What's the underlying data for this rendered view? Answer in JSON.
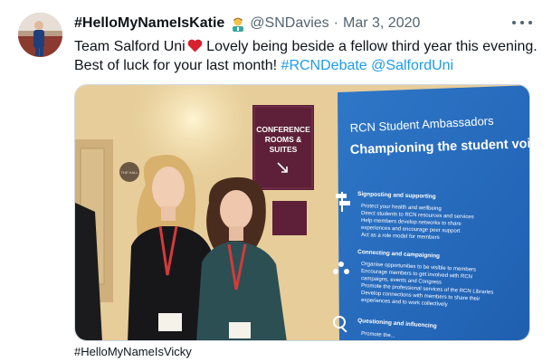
{
  "tweet": {
    "display_name": "#HelloMyNameIsKatie",
    "emoji_icon": "health-worker-emoji",
    "handle": "@SNDavies",
    "separator": "·",
    "date": "Mar 3, 2020",
    "text_part1": "Team Salford Uni",
    "text_part2": " Lovely being beside a fellow third year this evening.",
    "text_part3": "Best of luck for your last month! ",
    "hashtag": "#RCNDebate",
    "mention": "@SalfordUni",
    "link_color": "#1d9bf0",
    "more_icon": "more-horizontal-icon"
  },
  "media": {
    "sign_left_line1": "CONFERENCE",
    "sign_left_line2": "ROOMS &",
    "sign_left_line3": "SUITES",
    "door_sign": "THE HALL",
    "banner_title": "RCN Student Ambassadors",
    "banner_subtitle": "Championing the student voice",
    "section1_title": "Signposting and supporting",
    "section1_items": [
      "Protect your health and wellbeing",
      "Direct students to RCN resources and services",
      "Help members develop networks to share",
      "experiences and encourage peer support",
      "Act as a role model for members"
    ],
    "section2_title": "Connecting and campaigning",
    "section2_items": [
      "Organise opportunities to be visible to members",
      "Encourage members to get involved with RCN",
      "campaigns, events and Congress",
      "Promote the professional services of the RCN Libraries",
      "Develop connections with members to share their",
      "experiences and to work collectively"
    ],
    "section3_title": "Questioning and influencing",
    "section3_item": "Promote the..."
  },
  "caption": "#HelloMyNameIsVicky"
}
